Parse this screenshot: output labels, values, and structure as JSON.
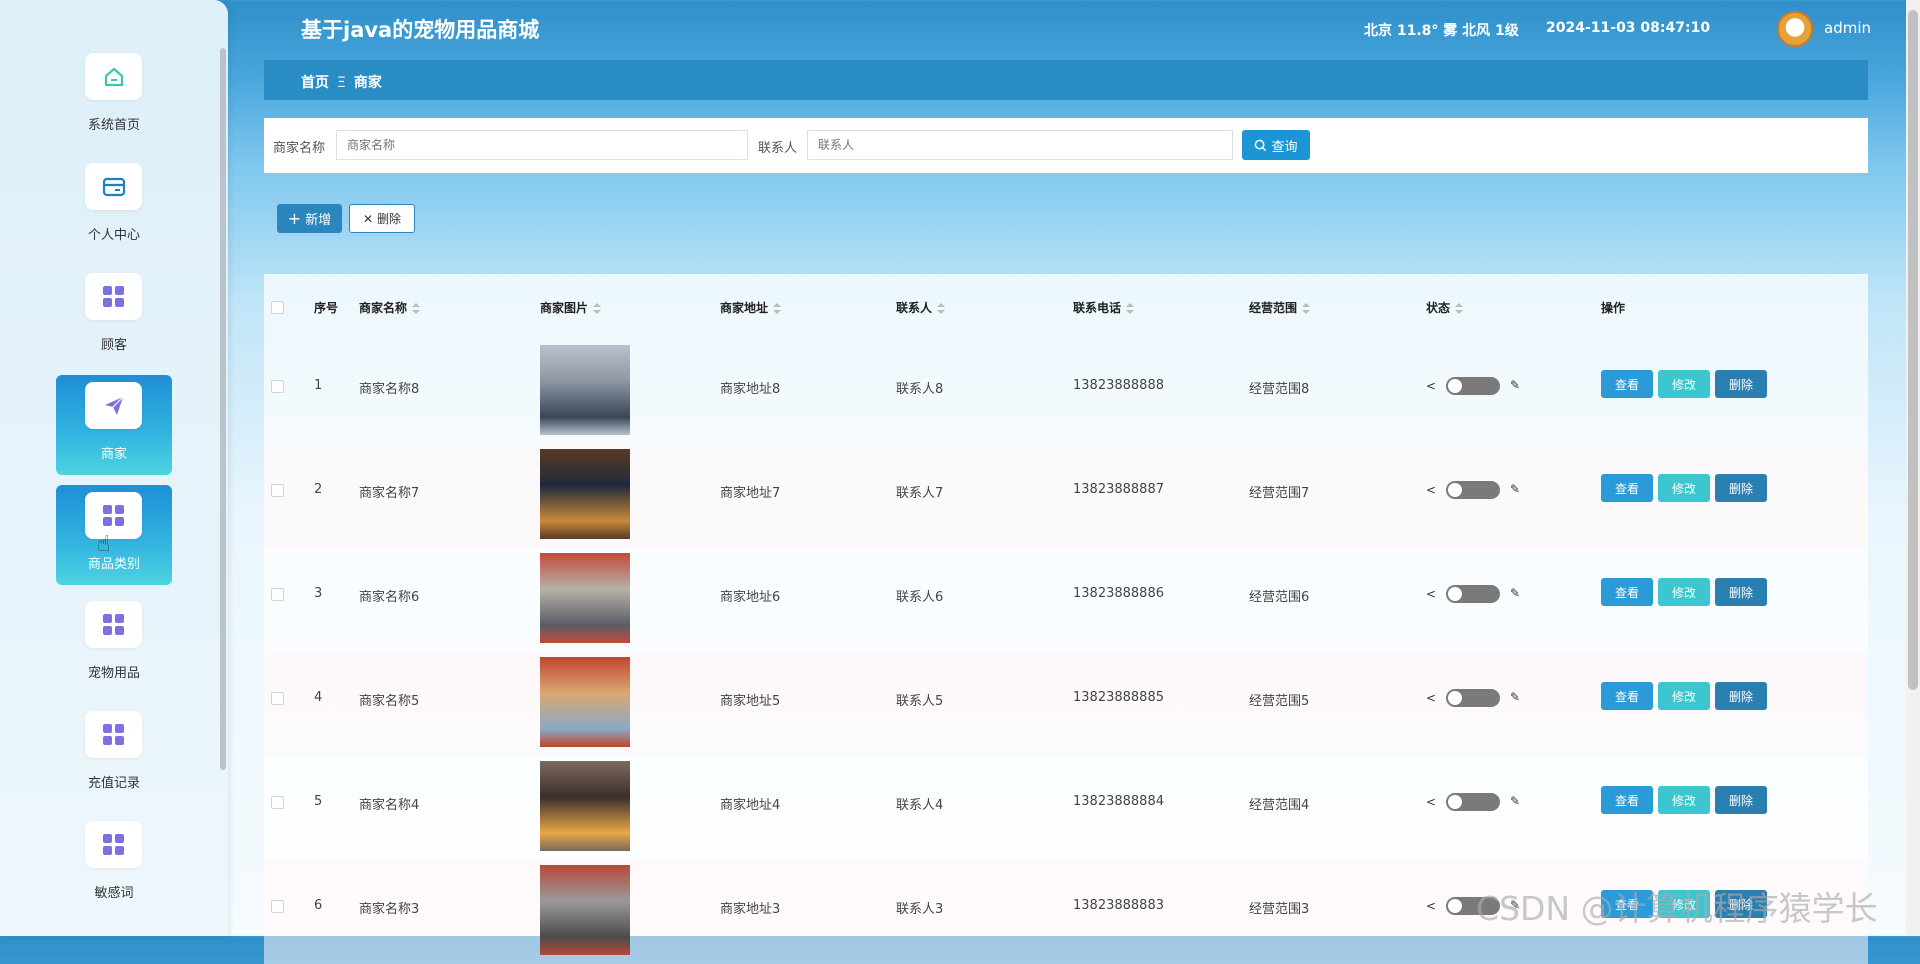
{
  "app": {
    "title": "基于java的宠物用品商城"
  },
  "header": {
    "weather": "北京 11.8° 雾 北风 1级",
    "datetime": "2024-11-03 08:47:10",
    "username": "admin"
  },
  "breadcrumb": {
    "home": "首页",
    "separator": "Ξ",
    "current": "商家"
  },
  "sidebar": {
    "items": [
      {
        "label": "系统首页",
        "icon": "home-icon"
      },
      {
        "label": "个人中心",
        "icon": "wallet-icon"
      },
      {
        "label": "顾客",
        "icon": "grid-icon"
      },
      {
        "label": "商家",
        "icon": "send-icon",
        "active": true
      },
      {
        "label": "商品类别",
        "icon": "grid-icon",
        "active": true
      },
      {
        "label": "宠物用品",
        "icon": "grid-icon"
      },
      {
        "label": "充值记录",
        "icon": "grid-icon"
      },
      {
        "label": "敏感词",
        "icon": "grid-icon"
      }
    ]
  },
  "search": {
    "name_label": "商家名称",
    "name_placeholder": "商家名称",
    "contact_label": "联系人",
    "contact_placeholder": "联系人",
    "button_label": "查询"
  },
  "toolbar": {
    "add_label": "新增",
    "delete_label": "删除"
  },
  "table": {
    "headers": [
      "序号",
      "商家名称",
      "商家图片",
      "商家地址",
      "联系人",
      "联系电话",
      "经营范围",
      "状态",
      "操作"
    ],
    "action_labels": {
      "view": "查看",
      "edit": "修改",
      "remove": "删除"
    },
    "rows": [
      {
        "index": "1",
        "name": "商家名称8",
        "address": "商家地址8",
        "contact": "联系人8",
        "phone": "13823888888",
        "scope": "经营范围8"
      },
      {
        "index": "2",
        "name": "商家名称7",
        "address": "商家地址7",
        "contact": "联系人7",
        "phone": "13823888887",
        "scope": "经营范围7"
      },
      {
        "index": "3",
        "name": "商家名称6",
        "address": "商家地址6",
        "contact": "联系人6",
        "phone": "13823888886",
        "scope": "经营范围6"
      },
      {
        "index": "4",
        "name": "商家名称5",
        "address": "商家地址5",
        "contact": "联系人5",
        "phone": "13823888885",
        "scope": "经营范围5"
      },
      {
        "index": "5",
        "name": "商家名称4",
        "address": "商家地址4",
        "contact": "联系人4",
        "phone": "13823888884",
        "scope": "经营范围4"
      },
      {
        "index": "6",
        "name": "商家名称3",
        "address": "商家地址3",
        "contact": "联系人3",
        "phone": "13823888883",
        "scope": "经营范围3"
      }
    ]
  },
  "watermark": "CSDN @计算机程序猿学长",
  "colors": {
    "primary": "#1c95d4",
    "header": "#2a8cc4",
    "edit": "#3cc6cf",
    "remove": "#2a7fb1",
    "icon_accent": "#7b72e0"
  }
}
